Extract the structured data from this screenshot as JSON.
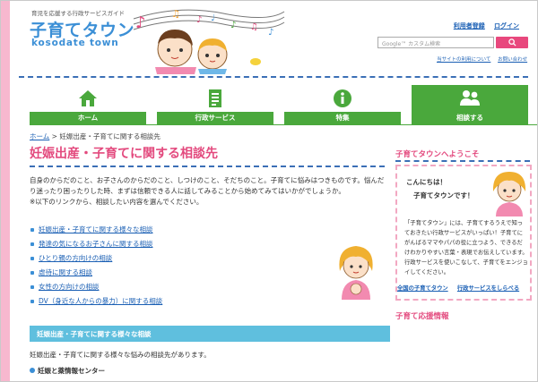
{
  "header": {
    "tagline": "育児を応援する行政サービスガイド",
    "logo_ja": "子育てタウン",
    "logo_en": "kosodate town",
    "links": [
      "利用者登録",
      "ログイン"
    ],
    "search_placeholder": "Google™ カスタム検索",
    "sub_links": [
      "当サイトの利用について",
      "お問い合わせ"
    ]
  },
  "nav": {
    "items": [
      {
        "label": "ホーム",
        "icon": "house-icon",
        "active": false
      },
      {
        "label": "行政サービス",
        "icon": "document-list-icon",
        "active": false
      },
      {
        "label": "特集",
        "icon": "info-icon",
        "active": false
      },
      {
        "label": "相談する",
        "icon": "people-icon",
        "active": true
      }
    ]
  },
  "breadcrumb": {
    "home": "ホーム",
    "separator": ">",
    "current": "妊娠出産・子育てに関する相談先"
  },
  "main": {
    "title": "妊娠出産・子育てに関する相談先",
    "intro_1": "自身のからだのこと、お子さんのからだのこと、しつけのこと、そだちのこと。子育てに悩みはつきものです。悩んだり迷ったり困ったりした時、まずは信頼できる人に話してみることから始めてみてはいかがでしょうか。",
    "intro_2": "※以下のリンクから、相談したい内容を選んでください。",
    "links": [
      "妊娠出産・子育てに関する様々な相談",
      "発達の気になるお子さんに関する相談",
      "ひとり親の方向けの相談",
      "虐待に関する相談",
      "女性の方向けの相談",
      "DV（身近な人からの暴力）に関する相談"
    ],
    "section_title": "妊娠出産・子育てに関する様々な相談",
    "section_text": "妊娠出産・子育てに関する様々な悩みの相談先があります。",
    "subhead": "妊娠と薬情報センター"
  },
  "sidebar": {
    "welcome_title": "子育てタウンへようこそ",
    "greeting_1": "こんにちは！",
    "greeting_2": "子育てタウンです！",
    "welcome_text": "「子育てタウン」には、子育てするうえで知っておきたい行政サービスがいっぱい！子育てにがんばるママやパパの役に立つよう、できるだけわかりやすい言葉・表現でお伝えしています。行政サービスを使いこなして、子育てをエンジョイしてください。",
    "links": [
      "全国の子育てタウン",
      "行政サービスをしらべる"
    ],
    "support_title": "子育て応援情報"
  },
  "colors": {
    "accent_pink": "#e34a7e",
    "nav_green": "#4aa83c",
    "link_blue": "#1a5fb4",
    "section_blue": "#5fbfde"
  }
}
